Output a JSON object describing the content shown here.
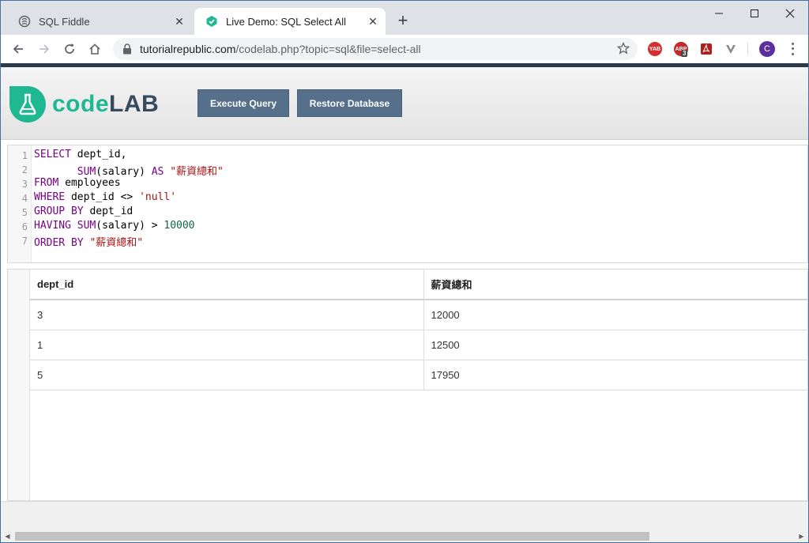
{
  "browser": {
    "tabs": [
      {
        "title": "SQL Fiddle",
        "active": false
      },
      {
        "title": "Live Demo: SQL Select All",
        "active": true
      }
    ],
    "new_tab_label": "+",
    "url_host": "tutorialrepublic.com",
    "url_path": "/codelab.php?topic=sql&file=select-all",
    "extensions": [
      "YAB",
      "ABP"
    ],
    "extension_badge": "3",
    "avatar_letter": "C",
    "accent_color": "#1fb892"
  },
  "header": {
    "logo_code": "cod",
    "logo_e": "e",
    "logo_lab": "LAB",
    "execute_label": "Execute Query",
    "restore_label": "Restore Database"
  },
  "editor": {
    "lines": [
      {
        "n": "1"
      },
      {
        "n": "2"
      },
      {
        "n": "3"
      },
      {
        "n": "4"
      },
      {
        "n": "5"
      },
      {
        "n": "6"
      },
      {
        "n": "7"
      }
    ],
    "tokens": {
      "l1_kw": "SELECT",
      "l1_rest": " dept_id,",
      "l2_indent": "       ",
      "l2_kw": "SUM",
      "l2_mid": "(salary) ",
      "l2_as": "AS",
      "l2_str": " \"薪資總和\"",
      "l3_kw": "FROM",
      "l3_rest": " employees",
      "l4_kw": "WHERE",
      "l4_mid": " dept_id <> ",
      "l4_str": "'null'",
      "l5_kw": "GROUP BY",
      "l5_rest": " dept_id",
      "l6_kw": "HAVING",
      "l6_kw2": " SUM",
      "l6_mid": "(salary) > ",
      "l6_num": "10000",
      "l7_kw": "ORDER BY",
      "l7_str": " \"薪資總和\""
    }
  },
  "results": {
    "columns": [
      "dept_id",
      "薪資總和"
    ],
    "rows": [
      [
        "3",
        "12000"
      ],
      [
        "1",
        "12500"
      ],
      [
        "5",
        "17950"
      ]
    ]
  }
}
